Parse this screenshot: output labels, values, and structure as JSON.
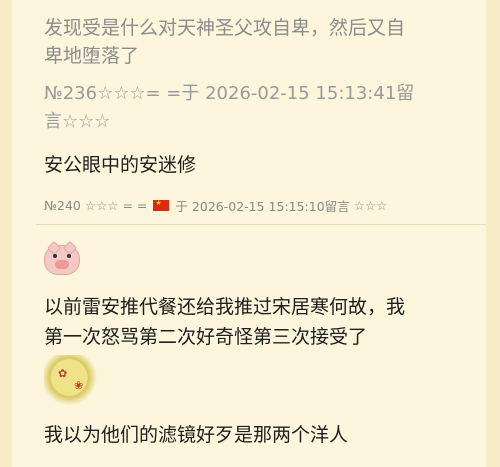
{
  "quote": {
    "line1": "发现受是什么对天神圣父攻自卑，然后又自",
    "line2": "卑地堕落了",
    "meta_line1": "№236☆☆☆= =于 2026-02-15 15:13:41留",
    "meta_line2": "言☆☆☆"
  },
  "post1": {
    "text": "安公眼中的安迷修",
    "meta_number": "№240",
    "meta_stars": "☆☆☆",
    "meta_eq": "= =",
    "meta_yu": "于",
    "meta_date": "2026-02-15 15:15:10留言",
    "meta_trailing": "☆☆☆"
  },
  "post2": {
    "line1": "以前雷安推代餐还给我推过宋居寒何故，我",
    "line2": "第一次怒骂第二次好奇怪第三次接受了"
  },
  "post3": {
    "line1": "我以为他们的滤镜好歹是那两个洋人"
  },
  "colors": {
    "background": "#fdf6dd",
    "meta_text": "#8a8a8a",
    "body_text": "#1e1e1e",
    "flag": "#de2910"
  }
}
